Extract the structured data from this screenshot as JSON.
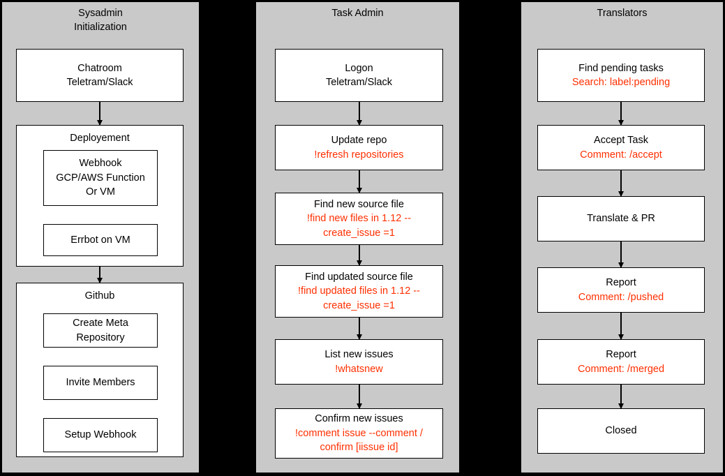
{
  "diagram": {
    "type": "swimlane-flowchart",
    "accent_red": "#ff2f00",
    "lane_background": "#c9c9c9",
    "gap_color": "#000000",
    "node_background": "#ffffff"
  },
  "lanes": [
    {
      "id": "sysadmin",
      "title": "Sysadmin\nInitialization",
      "nodes": [
        {
          "id": "chatroom",
          "line1": "Chatroom",
          "line2": "Teletram/Slack"
        },
        {
          "id": "deployement",
          "group_title": "Deployement",
          "children": [
            {
              "id": "webhook",
              "text": "Webhook\nGCP/AWS Function\nOr VM"
            },
            {
              "id": "errbot",
              "text": "Errbot on VM"
            }
          ]
        },
        {
          "id": "github",
          "group_title": "Github",
          "children": [
            {
              "id": "create-meta-repo",
              "text": "Create Meta\nRepository"
            },
            {
              "id": "invite-members",
              "text": "Invite Members"
            },
            {
              "id": "setup-webhook",
              "text": "Setup Webhook"
            }
          ]
        }
      ]
    },
    {
      "id": "task-admin",
      "title": "Task Admin",
      "nodes": [
        {
          "id": "logon",
          "line1": "Logon",
          "line2": "Teletram/Slack"
        },
        {
          "id": "update-repo",
          "line1": "Update repo",
          "line2": "!refresh repositories"
        },
        {
          "id": "find-new-source-file",
          "line1": "Find new source file",
          "line2": "!find new files in 1.12 --",
          "line3": "create_issue =1"
        },
        {
          "id": "find-updated-source-file",
          "line1": "Find updated source file",
          "line2": "!find updated files in 1.12 --",
          "line3": "create_issue =1"
        },
        {
          "id": "list-new-issues",
          "line1": "List new issues",
          "line2": "!whatsnew"
        },
        {
          "id": "confirm-new-issues",
          "line1": "Confirm new issues",
          "line2": "!comment issue --comment /",
          "line3": "confirm [iissue id]"
        }
      ]
    },
    {
      "id": "translators",
      "title": "Translators",
      "nodes": [
        {
          "id": "find-pending-tasks",
          "line1": "Find pending tasks",
          "line2": "Search: label:pending"
        },
        {
          "id": "accept-task",
          "line1": "Accept Task",
          "line2": "Comment: /accept"
        },
        {
          "id": "translate-pr",
          "line1": "Translate & PR",
          "line2": ""
        },
        {
          "id": "report-pushed",
          "line1": "Report",
          "line2": "Comment: /pushed"
        },
        {
          "id": "report-merged",
          "line1": "Report",
          "line2": "Comment: /merged"
        },
        {
          "id": "closed",
          "line1": "Closed",
          "line2": ""
        }
      ]
    }
  ]
}
